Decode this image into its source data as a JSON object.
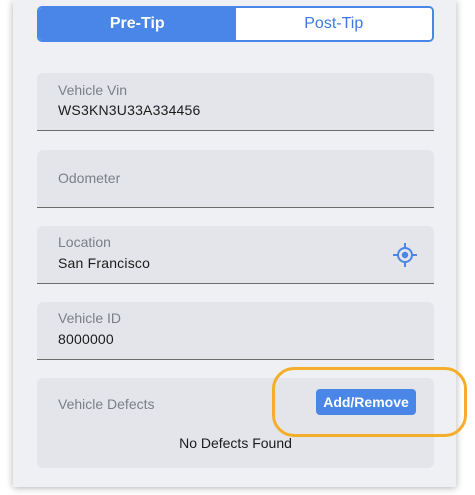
{
  "tabs": [
    {
      "label": "Pre-Tip",
      "active": true
    },
    {
      "label": "Post-Tip",
      "active": false
    }
  ],
  "fields": {
    "vin": {
      "label": "Vehicle Vin",
      "value": "WS3KN3U33A334456"
    },
    "odometer": {
      "label": "Odometer",
      "value": ""
    },
    "location": {
      "label": "Location",
      "value": "San Francisco",
      "icon": "locate-icon"
    },
    "vehicle_id": {
      "label": "Vehicle ID",
      "value": "8000000"
    }
  },
  "defects": {
    "label": "Vehicle Defects",
    "button_label": "Add/Remove",
    "empty_text": "No Defects Found"
  },
  "colors": {
    "accent": "#4a86e8",
    "highlight": "#f4ae2b",
    "field_bg": "#e3e5ea",
    "panel_bg": "#eef0f4"
  }
}
